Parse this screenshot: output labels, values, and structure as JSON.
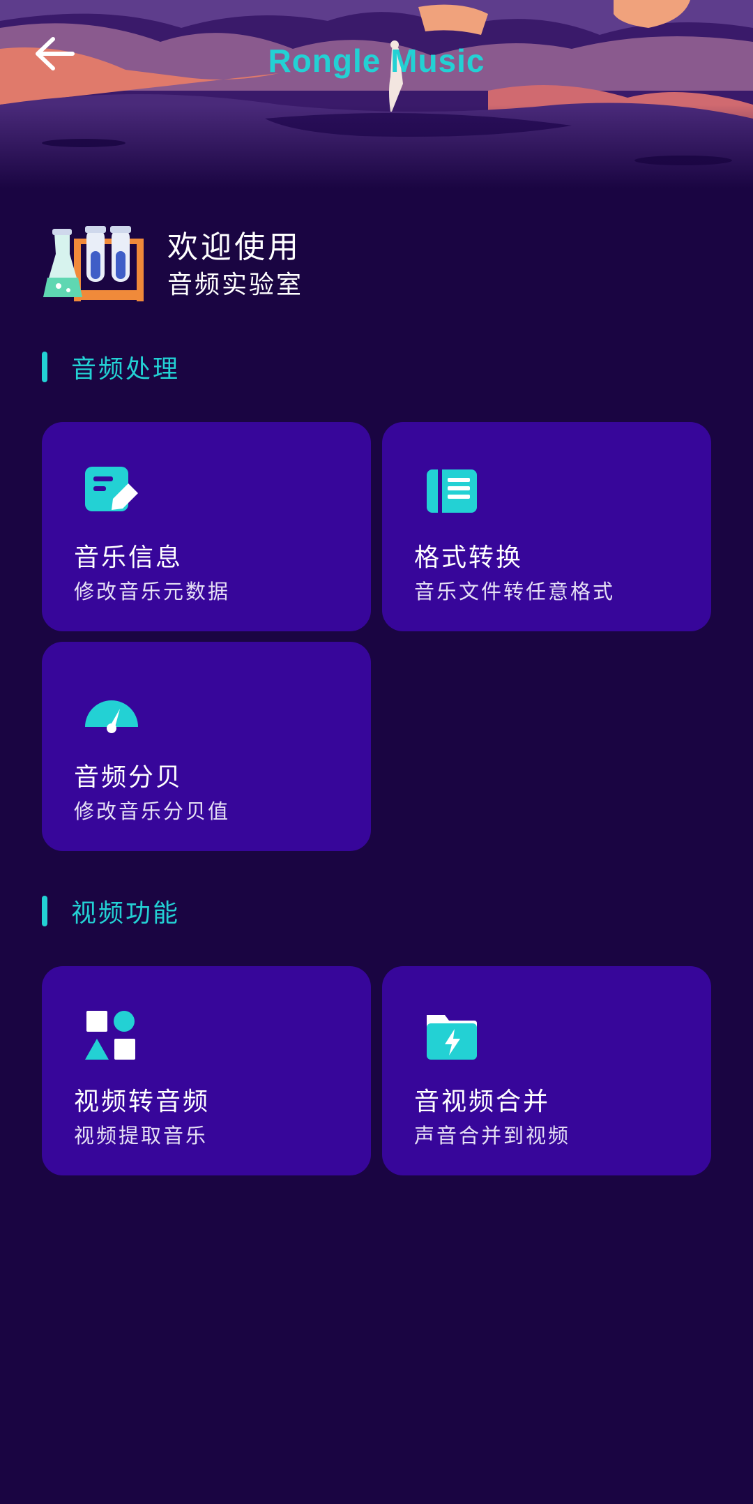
{
  "header": {
    "title": "Rongle Music",
    "back_icon": "arrow-left-icon"
  },
  "welcome": {
    "icon": "lab-flasks-icon",
    "title": "欢迎使用",
    "subtitle": "音频实验室"
  },
  "sections": [
    {
      "label": "音频处理",
      "cards": [
        {
          "title": "音乐信息",
          "desc": "修改音乐元数据",
          "icon": "edit-note-icon"
        },
        {
          "title": "格式转换",
          "desc": "音乐文件转任意格式",
          "icon": "book-icon"
        },
        {
          "title": "音频分贝",
          "desc": "修改音乐分贝值",
          "icon": "gauge-icon"
        }
      ]
    },
    {
      "label": "视频功能",
      "cards": [
        {
          "title": "视频转音频",
          "desc": "视频提取音乐",
          "icon": "shapes-icon"
        },
        {
          "title": "音视频合并",
          "desc": "声音合并到视频",
          "icon": "folder-lightning-icon"
        }
      ]
    }
  ],
  "colors": {
    "background": "#1a0542",
    "card": "#37069a",
    "accent": "#23d1d4"
  }
}
